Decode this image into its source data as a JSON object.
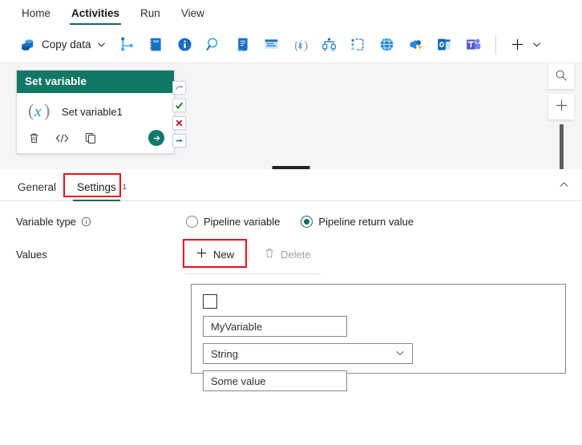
{
  "menu": {
    "items": [
      {
        "label": "Home",
        "active": false
      },
      {
        "label": "Activities",
        "active": true
      },
      {
        "label": "Run",
        "active": false
      },
      {
        "label": "View",
        "active": false
      }
    ]
  },
  "toolbar": {
    "copy_data_label": "Copy data",
    "icons": [
      {
        "name": "copy-data-icon"
      },
      {
        "name": "chevron-down-icon"
      },
      {
        "name": "if-condition-icon"
      },
      {
        "name": "notebook-icon"
      },
      {
        "name": "info-activity-icon"
      },
      {
        "name": "lookup-icon"
      },
      {
        "name": "script-icon"
      },
      {
        "name": "stored-procedure-icon"
      },
      {
        "name": "set-variable-icon"
      },
      {
        "name": "switch-icon"
      },
      {
        "name": "filter-icon"
      },
      {
        "name": "web-icon"
      },
      {
        "name": "webhook-icon"
      },
      {
        "name": "outlook-icon"
      },
      {
        "name": "teams-icon"
      },
      {
        "name": "add-icon"
      },
      {
        "name": "chevron-down-icon"
      }
    ]
  },
  "canvas": {
    "activity": {
      "header": "Set variable",
      "name": "Set variable1",
      "expression_icon": "fx-icon",
      "actions": [
        {
          "name": "delete-activity-icon"
        },
        {
          "name": "code-view-icon"
        },
        {
          "name": "clone-activity-icon"
        },
        {
          "name": "run-activity-icon"
        }
      ],
      "connectors": [
        {
          "name": "on-skip-connector",
          "glyph": "skip"
        },
        {
          "name": "on-success-connector",
          "glyph": "check"
        },
        {
          "name": "on-failure-connector",
          "glyph": "cross"
        },
        {
          "name": "on-completion-connector",
          "glyph": "arrow"
        }
      ]
    },
    "tools": {
      "search_icon": "search-icon",
      "zoom_in_icon": "plus-icon"
    }
  },
  "panel": {
    "tabs": [
      {
        "label": "General",
        "active": false,
        "superscript": "",
        "highlighted": false
      },
      {
        "label": "Settings",
        "active": true,
        "superscript": "1",
        "highlighted": true
      }
    ],
    "collapse_icon": "chevron-up-icon",
    "variable_type": {
      "label": "Variable type",
      "info_icon": "info-icon",
      "options": [
        {
          "label": "Pipeline variable",
          "selected": false
        },
        {
          "label": "Pipeline return value",
          "selected": true
        }
      ]
    },
    "values": {
      "label": "Values",
      "new_label": "New",
      "delete_label": "Delete",
      "new_icon": "plus-icon",
      "delete_icon": "trash-icon",
      "row": {
        "checkbox_checked": false,
        "name_value": "MyVariable",
        "type_value": "String",
        "value_value": "Some value"
      }
    }
  },
  "colors": {
    "accent_teal": "#0f6b5c",
    "card_header": "#117865",
    "highlight_red": "#e81123",
    "canvas_bg": "#f5f5f5",
    "superscript_red": "#a4262c"
  }
}
